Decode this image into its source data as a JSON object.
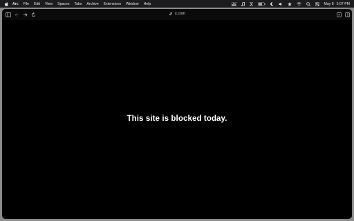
{
  "menubar": {
    "items": [
      "Arc",
      "File",
      "Edit",
      "View",
      "Spaces",
      "Tabs",
      "Archive",
      "Extensions",
      "Window",
      "Help"
    ],
    "status_icons": [
      "bar-chart-icon",
      "music-icon",
      "hourglass-icon",
      "battery-icon",
      "moon-icon",
      "volume-icon",
      "star-icon",
      "wifi-icon",
      "search-icon",
      "control-center-icon"
    ],
    "date": "May 8",
    "time": "5:07 PM"
  },
  "toolbar": {
    "icons": [
      "sidebar-toggle-icon",
      "back-arrow-icon",
      "forward-arrow-icon",
      "reload-icon",
      "extension-icon",
      "split-view-icon"
    ],
    "url": "x.com"
  },
  "content": {
    "message": "This site is blocked today."
  },
  "colors": {
    "menubar_bg": "#1c1c1e",
    "desktop_bg": "#8c8c8c",
    "content_bg": "#000000",
    "text": "#ffffff"
  }
}
